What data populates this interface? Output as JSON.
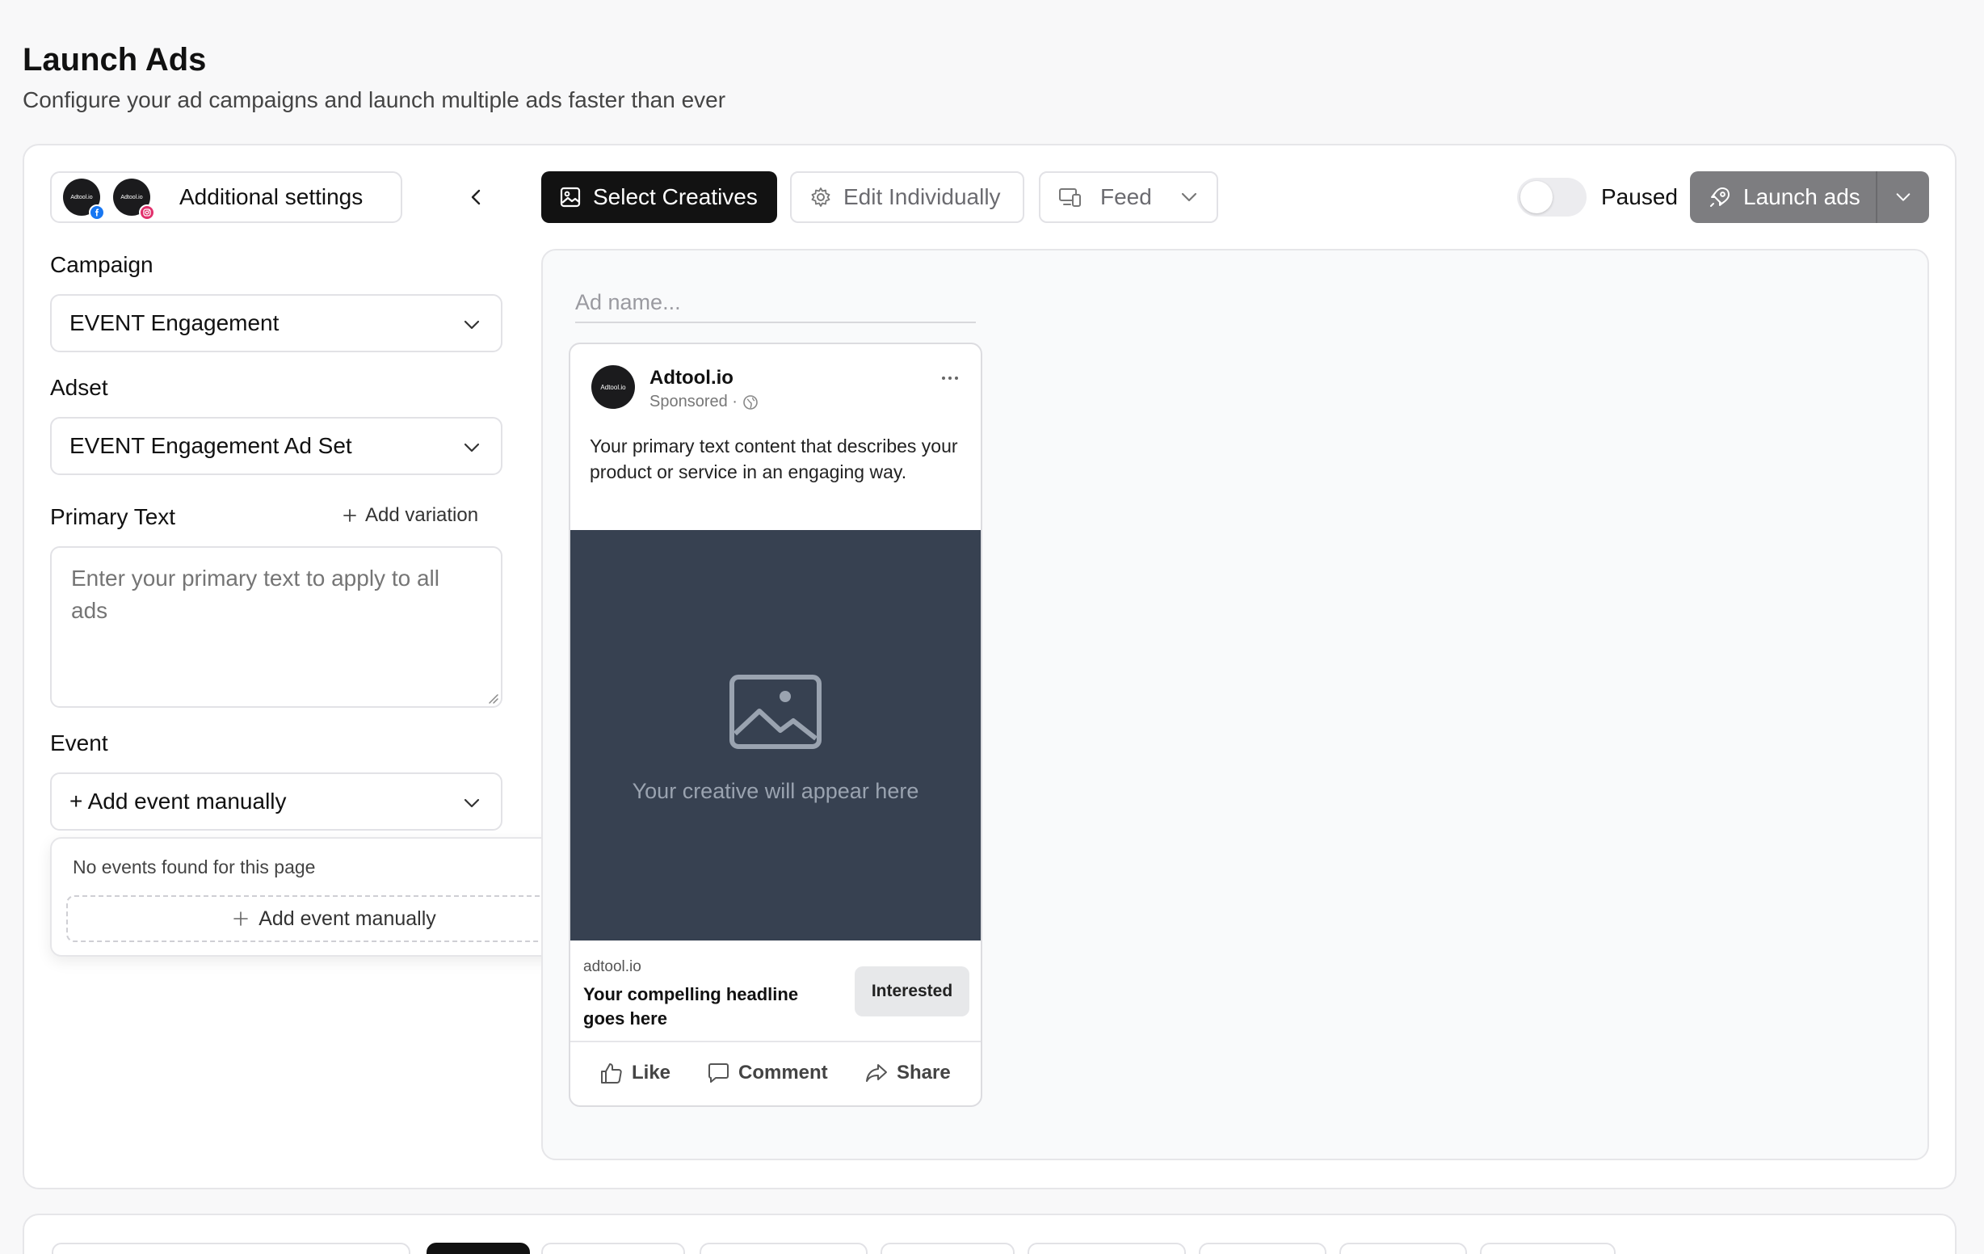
{
  "header": {
    "title": "Launch Ads",
    "subtitle": "Configure your ad campaigns and launch multiple ads faster than ever"
  },
  "settings": {
    "label": "Additional settings",
    "avatar_text": "Adtool.io",
    "icons": [
      "facebook-icon",
      "instagram-icon",
      "chevron-left-icon"
    ]
  },
  "campaign": {
    "label": "Campaign",
    "value": "EVENT Engagement"
  },
  "adset": {
    "label": "Adset",
    "value": "EVENT Engagement Ad Set"
  },
  "primary_text": {
    "label": "Primary Text",
    "add_variation": "Add variation",
    "placeholder": "Enter your primary text to apply to all ads"
  },
  "event": {
    "label": "Event",
    "value": "+ Add event manually",
    "no_events": "No events found for this page",
    "add_manual": "Add event manually"
  },
  "toolbar": {
    "select_creatives": "Select Creatives",
    "edit_individually": "Edit Individually",
    "feed": "Feed",
    "paused": "Paused",
    "launch_ads": "Launch ads",
    "toggle_on": false
  },
  "preview": {
    "ad_name_placeholder": "Ad name...",
    "brand": "Adtool.io",
    "avatar_text": "Adtool.io",
    "sponsored": "Sponsored ·",
    "primary": "Your primary text content that describes your product or service in an engaging way.",
    "media_text": "Your creative will appear here",
    "domain": "adtool.io",
    "headline": "Your compelling headline goes here",
    "cta": "Interested",
    "like": "Like",
    "comment": "Comment",
    "share": "Share"
  },
  "colors": {
    "primary_button": "#121212",
    "launch_button": "#7d7d80",
    "media_placeholder": "#374151",
    "facebook": "#1877f2",
    "instagram": "#e1306c"
  }
}
